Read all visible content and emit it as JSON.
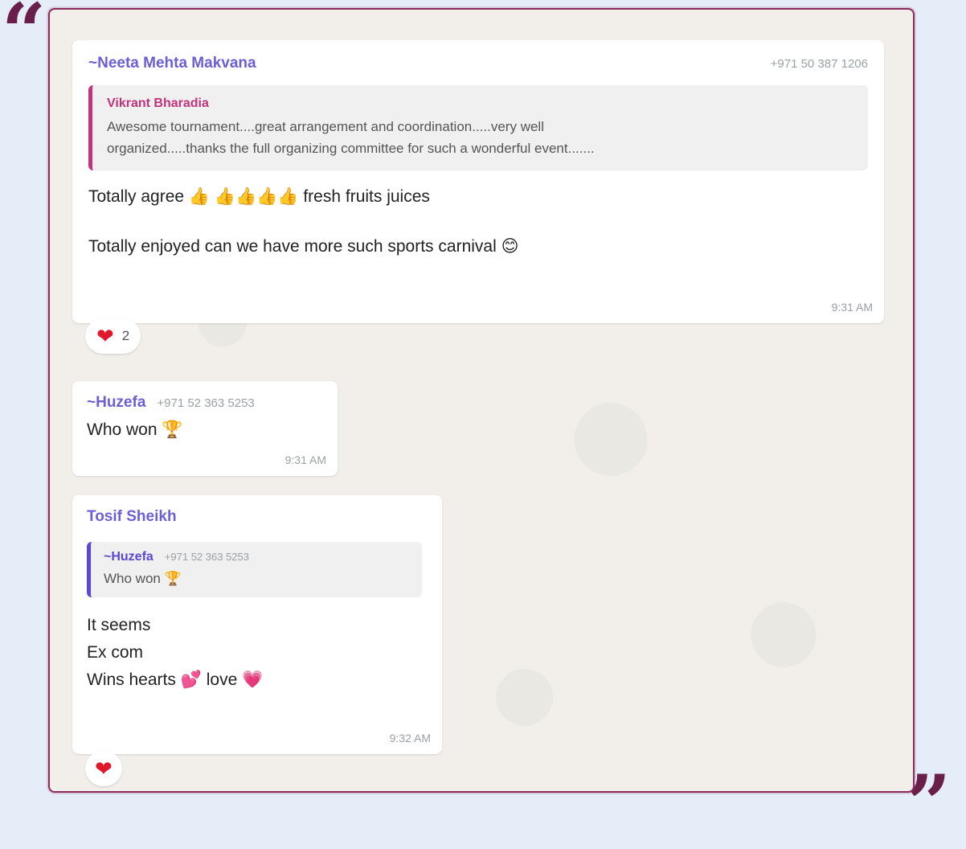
{
  "decor": {
    "open_quote": "“",
    "close_quote": "”"
  },
  "messages": [
    {
      "sender": "~Neeta Mehta Makvana",
      "phone": "+971 50 387 1206",
      "quoted": {
        "sender": "Vikrant Bharadia",
        "line1": "Awesome tournament....great arrangement and coordination.....very well",
        "line2": "organized.....thanks the full organizing committee for such a wonderful event......."
      },
      "line1_before": "Totally agree",
      "thumbs": "👍 👍👍👍👍",
      "line1_after": "fresh fruits juices",
      "line2": "Totally enjoyed can we have more such sports carnival",
      "smile": "😊",
      "time": "9:31 AM",
      "reaction_emoji": "❤",
      "reaction_count": "2"
    },
    {
      "sender": "~Huzefa",
      "phone": "+971 52 363 5253",
      "text": "Who won",
      "trophy": "🏆",
      "time": "9:31 AM"
    },
    {
      "sender": "Tosif Sheikh",
      "quoted": {
        "sender": "~Huzefa",
        "phone": "+971 52 363 5253",
        "text": "Who won",
        "trophy": "🏆"
      },
      "lines": [
        "It seems",
        "Ex com",
        "Wins hearts"
      ],
      "hearts_emoji": "💕",
      "love": "love",
      "pink_heart": "💗",
      "time": "9:32 AM",
      "reaction_emoji": "❤"
    }
  ],
  "colors": {
    "sender_purple": "#6b5fd6",
    "quote_pink": "#c2337a",
    "quote_purple": "#5b48d2",
    "frame_border": "#8a2b5e"
  }
}
